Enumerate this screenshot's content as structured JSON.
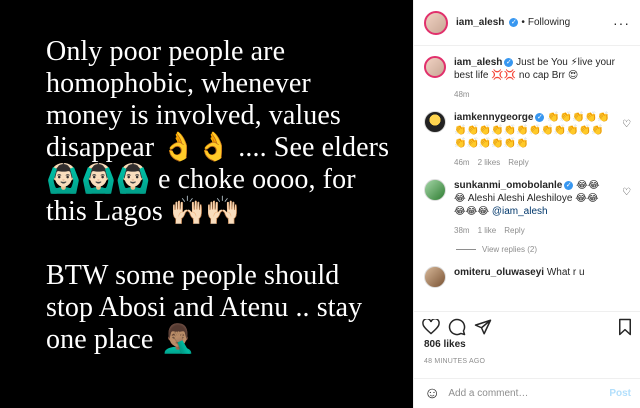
{
  "post_image": {
    "paragraphs": [
      [
        "Only poor people are",
        "homophobic, whenever",
        "money is involved, values",
        "disappear 👌👌 .... See elders",
        "🙆🏻‍♂️🙆🏻‍♂️🙆🏻‍♂️ e choke oooo, for",
        "this Lagos 🙌🏻🙌🏻"
      ],
      [
        "BTW some people should",
        "stop Abosi and Atenu .. stay",
        "one place 🤦🏽‍♂️"
      ]
    ]
  },
  "header": {
    "username": "iam_alesh",
    "verified_mark": "✓",
    "separator": "•",
    "follow_status": "Following",
    "more": "···"
  },
  "comments": [
    {
      "username": "iam_alesh",
      "verified": true,
      "text": "Just be You ⚡live your best life 💢💢 no cap Brr 😍",
      "time": "48m",
      "likes": "",
      "reply": "",
      "avatar": "main"
    },
    {
      "username": "iamkennygeorge",
      "verified": true,
      "text": "👏👏👏👏👏👏👏👏👏👏👏👏👏👏👏👏👏👏👏👏👏👏👏",
      "time": "46m",
      "likes": "2 likes",
      "reply": "Reply",
      "avatar": "black"
    },
    {
      "username": "sunkanmi_omobolanle",
      "verified": true,
      "text": "😂😂😂 Aleshi Aleshi Aleshiloye 😂😂😂😂😂 ",
      "mention": "@iam_alesh",
      "time": "38m",
      "likes": "1 like",
      "reply": "Reply",
      "avatar": "green"
    },
    {
      "username": "omiteru_oluwaseyi",
      "verified": false,
      "text": "What r u",
      "time": "",
      "likes": "",
      "reply": "",
      "avatar": "brown"
    }
  ],
  "view_replies": "View replies (2)",
  "likes_count": "806 likes",
  "timestamp": "48 MINUTES AGO",
  "add_comment": {
    "placeholder": "Add a comment…",
    "post_label": "Post",
    "emoji": "☺"
  },
  "icons": [
    "heart-icon",
    "comment-icon",
    "share-icon",
    "bookmark-icon",
    "emoji-icon",
    "more-icon"
  ]
}
